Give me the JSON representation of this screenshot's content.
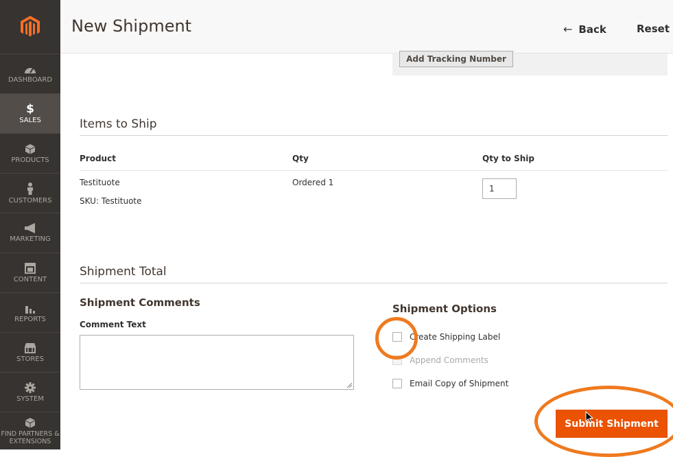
{
  "sidebar": {
    "items": [
      {
        "label": "DASHBOARD",
        "icon": "dashboard-icon"
      },
      {
        "label": "SALES",
        "icon": "dollar-icon",
        "glyph": "$",
        "active": true
      },
      {
        "label": "PRODUCTS",
        "icon": "cube-icon"
      },
      {
        "label": "CUSTOMERS",
        "icon": "person-icon"
      },
      {
        "label": "MARKETING",
        "icon": "megaphone-icon"
      },
      {
        "label": "CONTENT",
        "icon": "layout-icon"
      },
      {
        "label": "REPORTS",
        "icon": "bar-chart-icon"
      },
      {
        "label": "STORES",
        "icon": "store-icon"
      },
      {
        "label": "SYSTEM",
        "icon": "gear-icon"
      },
      {
        "label": "FIND PARTNERS & EXTENSIONS",
        "icon": "partners-icon"
      }
    ]
  },
  "header": {
    "title": "New Shipment",
    "back_arrow": "←",
    "back_label": "Back",
    "reset_label": "Reset"
  },
  "tracking": {
    "add_label": "Add Tracking Number"
  },
  "items_section": {
    "title": "Items to Ship",
    "columns": [
      "Product",
      "Qty",
      "Qty to Ship"
    ],
    "rows": [
      {
        "product": "Testituote",
        "sku": "SKU: Testituote",
        "qty": "Ordered 1",
        "qty_to_ship": "1"
      }
    ]
  },
  "total_section": {
    "title": "Shipment Total",
    "comments_title": "Shipment Comments",
    "comment_label": "Comment Text",
    "options_title": "Shipment Options",
    "options": [
      {
        "label": "Create Shipping Label",
        "checked": false,
        "disabled": false
      },
      {
        "label": "Append Comments",
        "checked": false,
        "disabled": true
      },
      {
        "label": "Email Copy of Shipment",
        "checked": false,
        "disabled": false
      }
    ],
    "submit_label": "Submit Shipment"
  },
  "colors": {
    "sidebar_bg": "#373330",
    "accent": "#eb5202",
    "annotation": "#ef7a1f",
    "logo": "#f46f25"
  }
}
